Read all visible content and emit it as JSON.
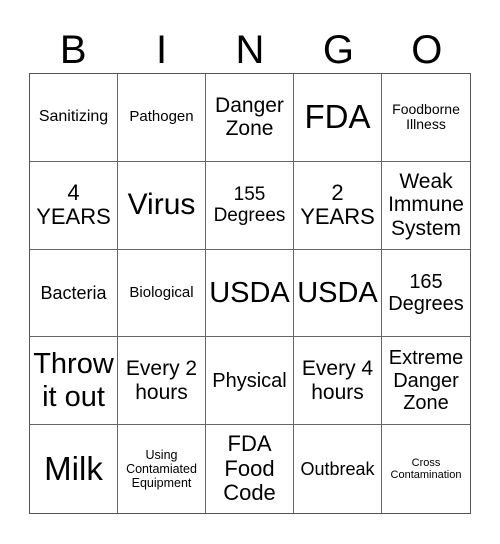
{
  "header": {
    "letters": [
      "B",
      "I",
      "N",
      "G",
      "O"
    ]
  },
  "board": {
    "rows": [
      [
        "Sanitizing",
        "Pathogen",
        "Danger Zone",
        "FDA",
        "Foodborne Illness"
      ],
      [
        "4 YEARS",
        "Virus",
        "155 Degrees",
        "2 YEARS",
        "Weak Immune System"
      ],
      [
        "Bacteria",
        "Biological",
        "USDA",
        "USDA",
        "165 Degrees"
      ],
      [
        "Throw it out",
        "Every 2 hours",
        "Physical",
        "Every 4 hours",
        "Extreme Danger Zone"
      ],
      [
        "Milk",
        "Using Contamiated Equipment",
        "FDA Food Code",
        "Outbreak",
        "Cross Contamination"
      ]
    ]
  }
}
